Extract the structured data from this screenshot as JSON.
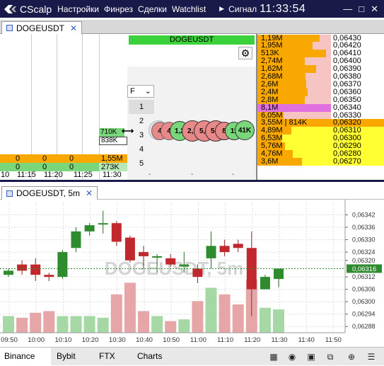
{
  "app": {
    "name": "CScalp",
    "menu": [
      "Настройки",
      "Финрез",
      "Сделки",
      "Watchlist"
    ],
    "signal_label": "Сигнал",
    "clock": "11:33:54"
  },
  "top_tab": {
    "label": "DOGEUSDT"
  },
  "scalper": {
    "ticker": "DOGEUSDT",
    "f_select": "F",
    "number_buttons": [
      "1",
      "2",
      "3",
      "4",
      "5"
    ],
    "dashes": [
      "-",
      "-",
      "-"
    ],
    "last_trade_values": [
      "710K",
      "838K"
    ],
    "bubbles": [
      "4",
      "4",
      "1,2",
      "2,1",
      "5,5",
      "5,6",
      "8",
      "11",
      "41K"
    ],
    "clusters": {
      "rows": [
        {
          "cells": [
            "0",
            "0",
            "0",
            "1,55M"
          ],
          "color": "#f8a800",
          "last_color": "#f8a800"
        },
        {
          "cells": [
            "0",
            "0",
            "0",
            "273K"
          ],
          "color": "#7ad67a",
          "last_color": "#b8e8b8"
        }
      ],
      "times": [
        "10",
        "11:15",
        "11:20",
        "11:25",
        "11:30"
      ]
    },
    "order_book": [
      {
        "vol": "1,19M",
        "price": "0,06430",
        "side": "ask",
        "bar": 0.22
      },
      {
        "vol": "1,95M",
        "price": "0,06420",
        "side": "ask",
        "bar": 0.35
      },
      {
        "vol": "513K",
        "price": "0,06410",
        "side": "ask",
        "bar": 0.1
      },
      {
        "vol": "2,74M",
        "price": "0,06400",
        "side": "ask",
        "bar": 0.5
      },
      {
        "vol": "1,62M",
        "price": "0,06390",
        "side": "ask",
        "bar": 0.28
      },
      {
        "vol": "2,68M",
        "price": "0,06380",
        "side": "ask",
        "bar": 0.48
      },
      {
        "vol": "2,6M",
        "price": "0,06370",
        "side": "ask",
        "bar": 0.47
      },
      {
        "vol": "2,4M",
        "price": "0,06360",
        "side": "ask",
        "bar": 0.44
      },
      {
        "vol": "2,8M",
        "price": "0,06350",
        "side": "ask",
        "bar": 0.5
      },
      {
        "vol": "8,1M",
        "price": "0,06340",
        "side": "ask-big",
        "bar": 1.0
      },
      {
        "vol": "6,05M",
        "price": "0,06330",
        "side": "ask",
        "bar": 0.9
      },
      {
        "vol": "3,55M | 814K",
        "price": "0,06320",
        "side": "current",
        "bar": 0.6
      },
      {
        "vol": "4,89M",
        "price": "0,06310",
        "side": "bid",
        "bar": 0.75
      },
      {
        "vol": "6,53M",
        "price": "0,06300",
        "side": "bid",
        "bar": 0.95
      },
      {
        "vol": "5,76M",
        "price": "0,06290",
        "side": "bid",
        "bar": 0.88
      },
      {
        "vol": "4,76M",
        "price": "0,06280",
        "side": "bid",
        "bar": 0.73
      },
      {
        "vol": "3,6M",
        "price": "0,06270",
        "side": "bid",
        "bar": 0.55
      }
    ]
  },
  "chart_tab": {
    "label": "DOGEUSDT, 5m"
  },
  "chart_data": {
    "type": "candlestick",
    "watermark": "DOGEUSDT, 5m",
    "x_labels": [
      "09:50",
      "10:00",
      "10:10",
      "10:20",
      "10:30",
      "10:40",
      "10:50",
      "11:00",
      "11:10",
      "11:20",
      "11:30",
      "11:40",
      "11:50"
    ],
    "y_ticks": [
      "0,06342",
      "0,06336",
      "0,06330",
      "0,06324",
      "0,06320",
      "0,06312",
      "0,06306",
      "0,06300",
      "0,06294",
      "0,06288"
    ],
    "y_tick_values": [
      0.06342,
      0.06336,
      0.0633,
      0.06324,
      0.0632,
      0.06312,
      0.06306,
      0.063,
      0.06294,
      0.06288
    ],
    "ylim": [
      0.06285,
      0.06348
    ],
    "last_price_label": "0,06316",
    "last_price": 0.06316,
    "candles": [
      {
        "t": "09:50",
        "o": 0.06313,
        "h": 0.06316,
        "c": 0.06315,
        "l": 0.06312
      },
      {
        "t": "09:55",
        "o": 0.06318,
        "h": 0.0632,
        "c": 0.06315,
        "l": 0.06313
      },
      {
        "t": "10:00",
        "o": 0.06318,
        "h": 0.06321,
        "c": 0.06313,
        "l": 0.0631
      },
      {
        "t": "10:05",
        "o": 0.06313,
        "h": 0.06314,
        "c": 0.06312,
        "l": 0.0631
      },
      {
        "t": "10:10",
        "o": 0.06312,
        "h": 0.06325,
        "c": 0.06324,
        "l": 0.06311
      },
      {
        "t": "10:15",
        "o": 0.06326,
        "h": 0.06336,
        "c": 0.06334,
        "l": 0.06324
      },
      {
        "t": "10:20",
        "o": 0.06334,
        "h": 0.06338,
        "c": 0.06337,
        "l": 0.06332
      },
      {
        "t": "10:25",
        "o": 0.06338,
        "h": 0.06344,
        "c": 0.06338,
        "l": 0.06333
      },
      {
        "t": "10:30",
        "o": 0.06338,
        "h": 0.06339,
        "c": 0.06329,
        "l": 0.06327
      },
      {
        "t": "10:35",
        "o": 0.06331,
        "h": 0.06332,
        "c": 0.0632,
        "l": 0.06319
      },
      {
        "t": "10:40",
        "o": 0.06324,
        "h": 0.06327,
        "c": 0.06322,
        "l": 0.06316
      },
      {
        "t": "10:45",
        "o": 0.06322,
        "h": 0.06323,
        "c": 0.06322,
        "l": 0.06314
      },
      {
        "t": "10:50",
        "o": 0.06321,
        "h": 0.06323,
        "c": 0.06318,
        "l": 0.06317
      },
      {
        "t": "10:55",
        "o": 0.06317,
        "h": 0.06324,
        "c": 0.06318,
        "l": 0.06314
      },
      {
        "t": "11:00",
        "o": 0.06316,
        "h": 0.06318,
        "c": 0.06312,
        "l": 0.06309
      },
      {
        "t": "11:05",
        "o": 0.06321,
        "h": 0.06334,
        "c": 0.06327,
        "l": 0.06316
      },
      {
        "t": "11:10",
        "o": 0.06327,
        "h": 0.0633,
        "c": 0.06324,
        "l": 0.06322
      },
      {
        "t": "11:15",
        "o": 0.06328,
        "h": 0.0633,
        "c": 0.06326,
        "l": 0.06324
      },
      {
        "t": "11:20",
        "o": 0.06326,
        "h": 0.06334,
        "c": 0.06306,
        "l": 0.06293
      },
      {
        "t": "11:25",
        "o": 0.06306,
        "h": 0.06313,
        "c": 0.06312,
        "l": 0.06306
      },
      {
        "t": "11:30",
        "o": 0.06311,
        "h": 0.06316,
        "c": 0.06316,
        "l": 0.06307
      }
    ],
    "volumes": [
      0.1,
      0.09,
      0.12,
      0.13,
      0.1,
      0.1,
      0.1,
      0.09,
      0.23,
      0.3,
      0.13,
      0.1,
      0.07,
      0.08,
      0.19,
      0.27,
      0.23,
      0.17,
      0.32,
      0.15,
      0.14
    ],
    "up_color": "#2e8b2e",
    "down_color": "#c0282d",
    "vol_up_color": "#a6d8a6",
    "vol_down_color": "#e6a6a8"
  },
  "bottom_tabs": [
    "Binance",
    "Bybit",
    "FTX",
    "Charts"
  ],
  "bottom_icons": [
    "layout-icon",
    "eye-icon",
    "add-window-icon",
    "copy-window-icon",
    "chart-add-icon",
    "list-add-icon"
  ]
}
